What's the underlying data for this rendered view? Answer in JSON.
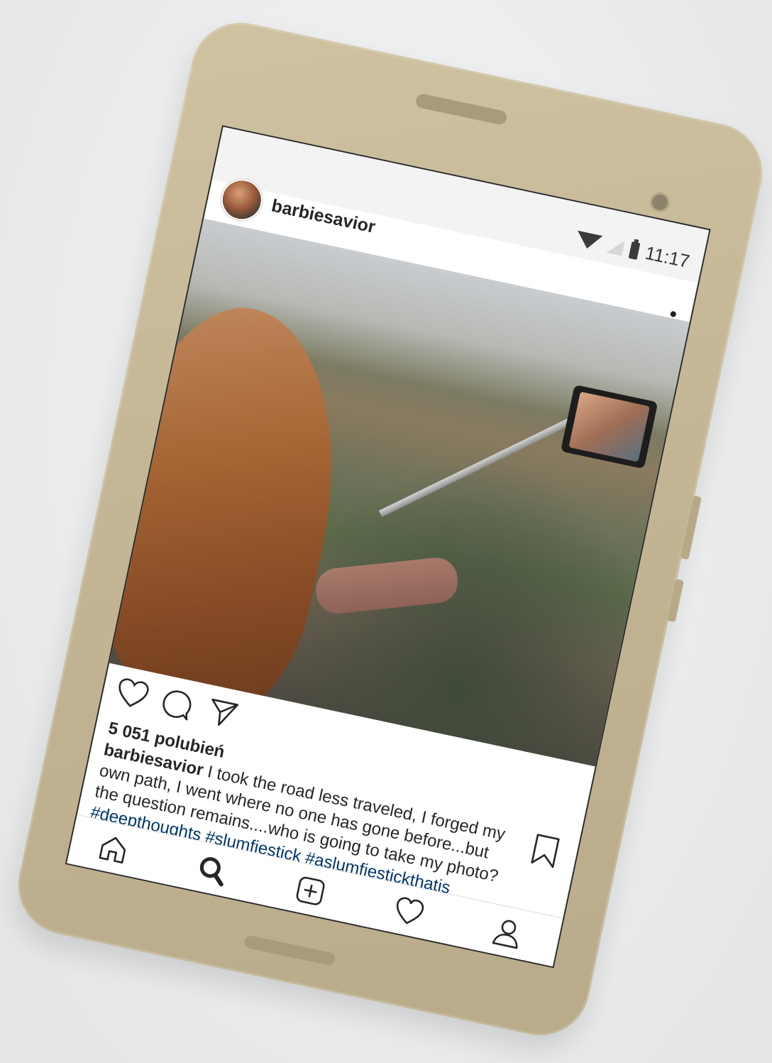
{
  "status_bar": {
    "time": "11:17",
    "icons": [
      "wifi-icon",
      "signal-icon",
      "battery-icon"
    ]
  },
  "post": {
    "username": "barbiesavior",
    "likes": "5 051 polubień",
    "caption_user": "barbiesavior",
    "caption_text": " I took the road less traveled, I forged my own path, I went where no one has gone before...but the question remains....who is going to take my photo? ",
    "hashtags": "#deepthoughts #slumfiestick #aslumfiestickthatis #itsjustmemyselfandi #allbymyself #slumfiedeogloria #solorideuntilidie #igotmeforlife",
    "actions": [
      "heart-icon",
      "comment-icon",
      "share-icon",
      "bookmark-icon"
    ],
    "more_icon": "more-vertical-icon"
  },
  "bottom_nav": {
    "items": [
      "home-icon",
      "search-icon",
      "add-icon",
      "activity-heart-icon",
      "profile-icon"
    ]
  },
  "colors": {
    "phone_body": "#c4b695",
    "hashtag": "#003569",
    "text": "#262626"
  }
}
